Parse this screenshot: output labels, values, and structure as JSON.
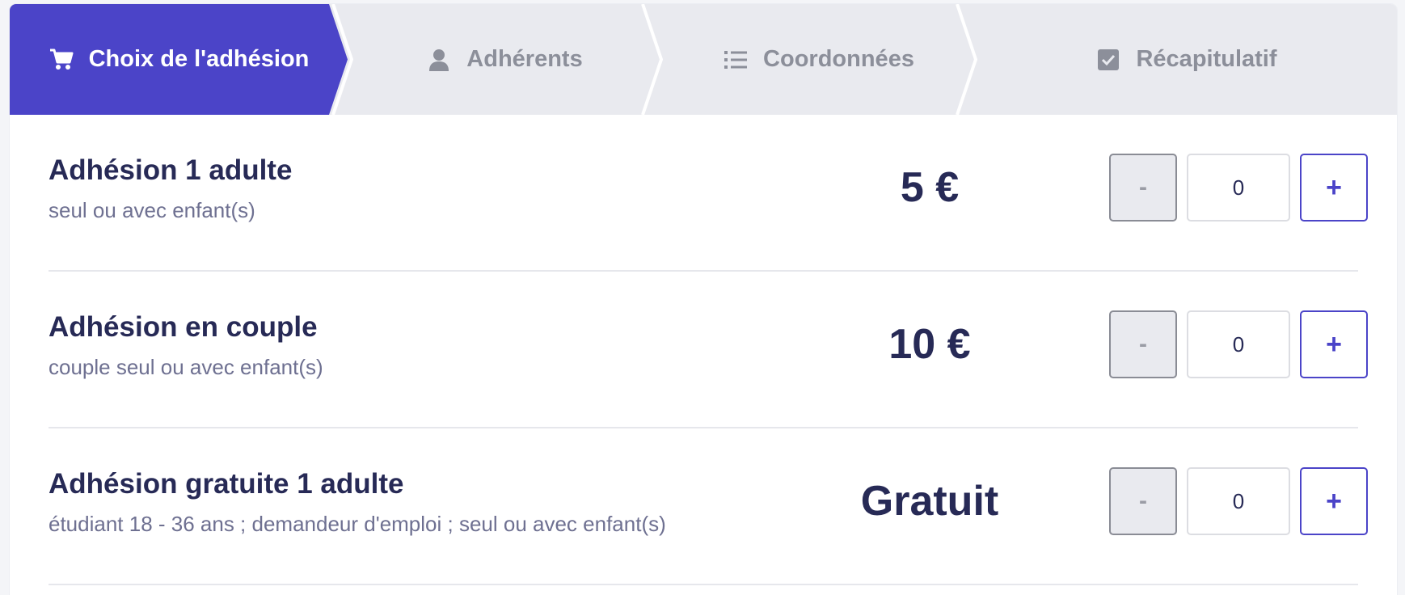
{
  "colors": {
    "accent": "#4b44c8",
    "step_inactive_bg": "#e9eaef",
    "text_primary": "#272a56",
    "text_secondary": "#6e7091"
  },
  "stepper": {
    "steps": [
      {
        "label": "Choix de l'adhésion",
        "icon": "cart-icon",
        "active": true
      },
      {
        "label": "Adhérents",
        "icon": "user-icon",
        "active": false
      },
      {
        "label": "Coordonnées",
        "icon": "list-icon",
        "active": false
      },
      {
        "label": "Récapitulatif",
        "icon": "checkbox-icon",
        "active": false
      }
    ]
  },
  "items": [
    {
      "name": "Adhésion 1 adulte",
      "description": "seul ou avec enfant(s)",
      "price": "5 €",
      "quantity": "0",
      "minus": "-",
      "plus": "+"
    },
    {
      "name": "Adhésion en couple",
      "description": "couple seul ou avec enfant(s)",
      "price": "10 €",
      "quantity": "0",
      "minus": "-",
      "plus": "+"
    },
    {
      "name": "Adhésion gratuite 1 adulte",
      "description": "étudiant 18 - 36 ans ; demandeur d'emploi ; seul ou avec enfant(s)",
      "price": "Gratuit",
      "quantity": "0",
      "minus": "-",
      "plus": "+"
    }
  ]
}
